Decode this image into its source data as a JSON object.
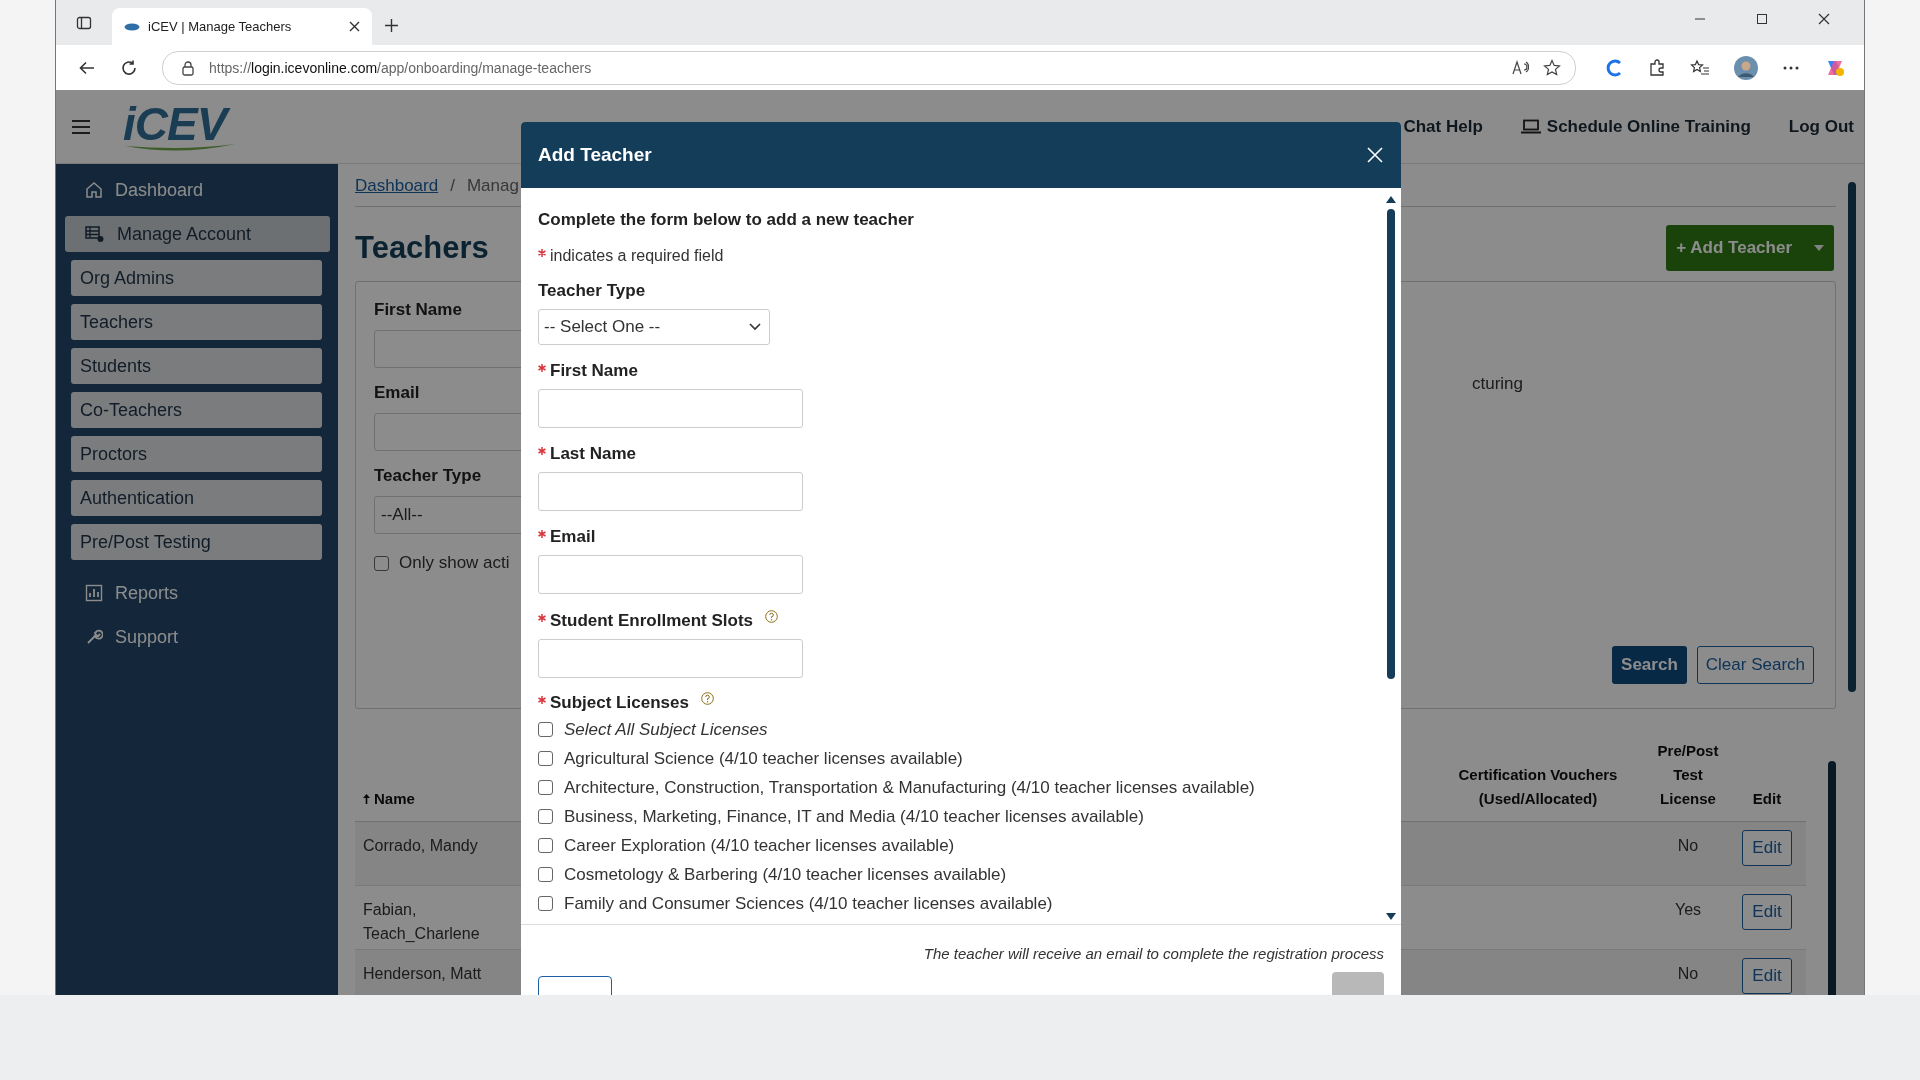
{
  "browser": {
    "tab_title": "iCEV | Manage Teachers",
    "url_prefix": "https://",
    "url_host": "login.icevonline.com",
    "url_path": "/app/onboarding/manage-teachers"
  },
  "header": {
    "logo": "iCEV",
    "links": [
      {
        "label": "Chat Help",
        "kind": "text"
      },
      {
        "label": "Schedule Online Training",
        "kind": "laptop"
      },
      {
        "label": "Log Out",
        "kind": "text"
      }
    ]
  },
  "sidebar": {
    "items": [
      {
        "label": "Dashboard",
        "kind": "icon",
        "selected": false
      },
      {
        "label": "Manage Account",
        "kind": "icon",
        "selected": true
      },
      {
        "label": "Org Admins",
        "kind": "box",
        "selected": false
      },
      {
        "label": "Teachers",
        "kind": "box",
        "selected": false
      },
      {
        "label": "Students",
        "kind": "box",
        "selected": false
      },
      {
        "label": "Co-Teachers",
        "kind": "box",
        "selected": false
      },
      {
        "label": "Proctors",
        "kind": "box",
        "selected": false
      },
      {
        "label": "Authentication",
        "kind": "box",
        "selected": false
      },
      {
        "label": "Pre/Post Testing",
        "kind": "box",
        "selected": false
      },
      {
        "label": "Reports",
        "kind": "icon",
        "selected": false
      },
      {
        "label": "Support",
        "kind": "icon",
        "selected": false
      }
    ]
  },
  "page": {
    "breadcrumb": {
      "link": "Dashboard",
      "separator": "/",
      "current": "Manag"
    },
    "title": "Teachers",
    "add_button": "+ Add Teacher",
    "filters": {
      "first_name_label": "First Name",
      "email_label": "Email",
      "teacher_type_label": "Teacher Type",
      "teacher_type_value": "--All--",
      "active_only": {
        "label": "Only show acti",
        "checked": false
      },
      "partial_text": "cturing",
      "search_button": "Search",
      "clear_button": "Clear Search"
    },
    "table": {
      "name_column": {
        "label": "Name",
        "sorted": true
      },
      "columns": [
        "Certification Vouchers (Used/Allocated)",
        "Pre/Post Test License",
        "Edit"
      ],
      "rows": [
        {
          "name": "Corrado, Mandy",
          "pre_post": "No",
          "edit": "Edit"
        },
        {
          "name": "Fabian, Teach_Charlene",
          "pre_post": "Yes",
          "edit": "Edit"
        },
        {
          "name": "Henderson, Matt",
          "pre_post": "No",
          "edit": "Edit"
        }
      ]
    }
  },
  "modal": {
    "title": "Add Teacher",
    "intro": "Complete the form below to add a new teacher",
    "required_note": "indicates a required field",
    "fields": [
      {
        "label": "Teacher Type",
        "required": false,
        "kind": "select",
        "value": "-- Select One --",
        "help": false
      },
      {
        "label": "First Name",
        "required": true,
        "kind": "input",
        "help": false
      },
      {
        "label": "Last Name",
        "required": true,
        "kind": "input",
        "help": false
      },
      {
        "label": "Email",
        "required": true,
        "kind": "input",
        "help": false
      },
      {
        "label": "Student Enrollment Slots",
        "required": true,
        "kind": "input",
        "help": true
      }
    ],
    "licenses": {
      "label": "Subject Licenses",
      "required": true,
      "help": true,
      "options": [
        {
          "label": "Select All Subject Licenses",
          "kind": "all",
          "checked": false
        },
        {
          "label": "Agricultural Science (4/10 teacher licenses available)",
          "kind": "subject",
          "checked": false
        },
        {
          "label": "Architecture, Construction, Transportation & Manufacturing (4/10 teacher licenses available)",
          "kind": "subject",
          "checked": false
        },
        {
          "label": "Business, Marketing, Finance, IT and Media (4/10 teacher licenses available)",
          "kind": "subject",
          "checked": false
        },
        {
          "label": "Career Exploration (4/10 teacher licenses available)",
          "kind": "subject",
          "checked": false
        },
        {
          "label": "Cosmetology & Barbering (4/10 teacher licenses available)",
          "kind": "subject",
          "checked": false
        },
        {
          "label": "Family and Consumer Sciences (4/10 teacher licenses available)",
          "kind": "subject",
          "checked": false
        }
      ]
    },
    "footer_note": "The teacher will receive an email to complete the registration process"
  }
}
